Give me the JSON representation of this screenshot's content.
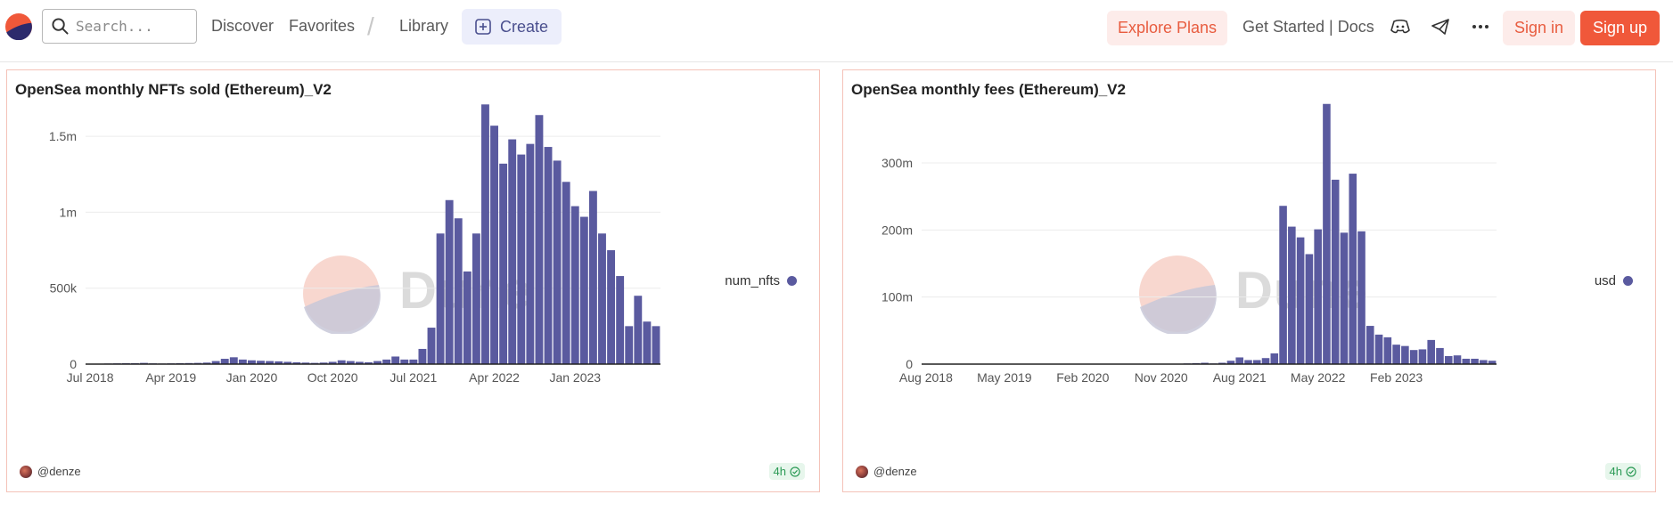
{
  "header": {
    "search_placeholder": "Search...",
    "nav": {
      "discover": "Discover",
      "favorites": "Favorites",
      "library": "Library",
      "create": "Create"
    },
    "explore_plans": "Explore Plans",
    "docs": "Get Started | Docs",
    "sign_in": "Sign in",
    "sign_up": "Sign up",
    "icons": [
      "dune-logo-icon",
      "search-icon",
      "plus-square-icon",
      "discord-icon",
      "telegram-icon",
      "more-icon"
    ],
    "accent_color": "#f0583a"
  },
  "watermark_text": "Dune",
  "panels": [
    {
      "title": "OpenSea monthly NFTs sold (Ethereum)_V2",
      "legend": "num_nfts",
      "author": "@denze",
      "age": "4h"
    },
    {
      "title": "OpenSea monthly fees (Ethereum)_V2",
      "legend": "usd",
      "author": "@denze",
      "age": "4h"
    }
  ],
  "chart_data": [
    {
      "type": "bar",
      "title": "OpenSea monthly NFTs sold (Ethereum)_V2",
      "series": [
        {
          "name": "num_nfts",
          "color": "#5a5a9f"
        }
      ],
      "x_start": "2018-07",
      "x_tick_labels": [
        "Jul 2018",
        "Apr 2019",
        "Jan 2020",
        "Oct 2020",
        "Jul 2021",
        "Apr 2022",
        "Jan 2023"
      ],
      "y_ticks": [
        0,
        500000,
        1000000,
        1500000
      ],
      "y_tick_labels": [
        "0",
        "500k",
        "1m",
        "1.5m"
      ],
      "ylim": [
        0,
        1700000
      ],
      "values": [
        2000,
        3000,
        4000,
        5000,
        6000,
        6000,
        8000,
        5000,
        4000,
        5000,
        6000,
        7000,
        8000,
        10000,
        20000,
        35000,
        45000,
        30000,
        25000,
        22000,
        20000,
        18000,
        15000,
        12000,
        10000,
        8000,
        10000,
        15000,
        25000,
        20000,
        15000,
        12000,
        20000,
        30000,
        50000,
        30000,
        30000,
        100000,
        240000,
        860000,
        1080000,
        960000,
        610000,
        860000,
        1710000,
        1570000,
        1320000,
        1480000,
        1380000,
        1450000,
        1640000,
        1430000,
        1340000,
        1200000,
        1040000,
        970000,
        1140000,
        860000,
        750000,
        580000,
        250000,
        450000,
        280000,
        250000
      ]
    },
    {
      "type": "bar",
      "title": "OpenSea monthly fees (Ethereum)_V2",
      "series": [
        {
          "name": "usd",
          "color": "#5a5a9f"
        }
      ],
      "x_start": "2018-08",
      "x_tick_labels": [
        "Aug 2018",
        "May 2019",
        "Feb 2020",
        "Nov 2020",
        "Aug 2021",
        "May 2022",
        "Feb 2023"
      ],
      "y_ticks": [
        0,
        100000000,
        200000000,
        300000000
      ],
      "y_tick_labels": [
        "0",
        "100m",
        "200m",
        "300m"
      ],
      "ylim": [
        0,
        385000000
      ],
      "values": [
        0,
        0,
        0,
        0,
        0,
        0,
        0,
        0,
        0,
        0,
        0,
        0,
        0,
        0,
        0,
        0,
        0,
        0,
        0,
        0,
        0,
        0,
        0,
        0,
        0,
        0,
        0,
        0,
        0,
        500000,
        1000000,
        1500000,
        2000000,
        1000000,
        2000000,
        5000000,
        10000000,
        6000000,
        6000000,
        9000000,
        16000000,
        236000000,
        205000000,
        189000000,
        164000000,
        201000000,
        388000000,
        275000000,
        196000000,
        284000000,
        198000000,
        57000000,
        44000000,
        40000000,
        29000000,
        27000000,
        21000000,
        22000000,
        36000000,
        24000000,
        12000000,
        13000000,
        8000000,
        8000000,
        6000000,
        5000000
      ]
    }
  ]
}
